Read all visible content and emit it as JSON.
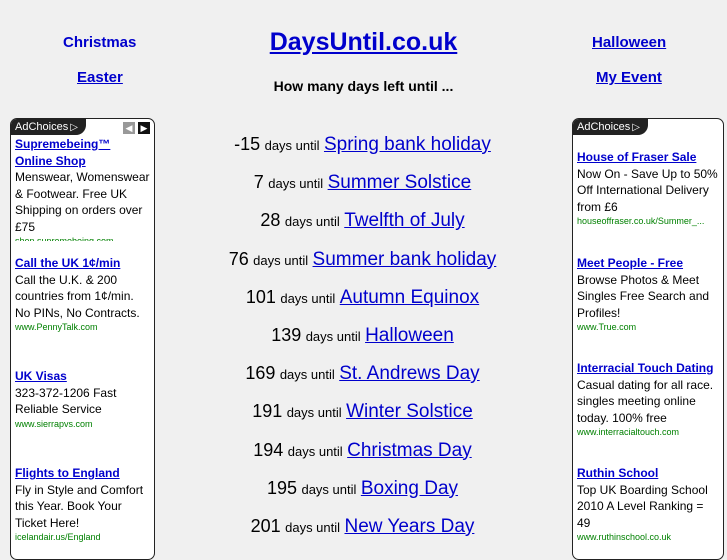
{
  "nav": {
    "christmas": "Christmas",
    "easter": "Easter",
    "halloween": "Halloween",
    "my_event": "My Event"
  },
  "site": {
    "title": "DaysUntil.co.uk",
    "subtitle": "How many days left until ..."
  },
  "ads_left": {
    "adchoices_label": "AdChoices",
    "prev_icon": "chevron-left-icon",
    "next_icon": "chevron-right-icon",
    "items": [
      {
        "title": "Supremebeing™ Online Shop",
        "body": "Menswear, Womenswear & Footwear. Free UK Shipping on orders over £75",
        "url": "shop.supremebeing.com"
      },
      {
        "title": "Call the UK 1¢/min",
        "body": "Call the U.K. & 200 countries from 1¢/min. No PINs, No Contracts.",
        "url": "www.PennyTalk.com"
      },
      {
        "title": "UK Visas",
        "body": "323-372-1206 Fast Reliable Service",
        "url": "www.sierrapvs.com"
      },
      {
        "title": "Flights to England",
        "body": "Fly in Style and Comfort this Year. Book Your Ticket Here!",
        "url": "icelandair.us/England"
      }
    ]
  },
  "ads_right": {
    "adchoices_label": "AdChoices",
    "items": [
      {
        "title": "House of Fraser Sale",
        "body": "Now On - Save Up to 50% Off International Delivery from £6",
        "url": "houseoffraser.co.uk/Summer_..."
      },
      {
        "title": "Meet People - Free",
        "body": "Browse Photos & Meet Singles Free Search and Profiles!",
        "url": "www.True.com"
      },
      {
        "title": "Interracial Touch Dating",
        "body": "Casual dating for all race. singles meeting online today. 100% free",
        "url": "www.interracialtouch.com"
      },
      {
        "title": "Ruthin School",
        "body": "Top UK Boarding School 2010 A Level Ranking = 49",
        "url": "www.ruthinschool.co.uk"
      }
    ]
  },
  "days_until_label": "days until",
  "events": [
    {
      "days": "-15",
      "name": "Spring bank holiday"
    },
    {
      "days": "7",
      "name": "Summer Solstice"
    },
    {
      "days": "28",
      "name": "Twelfth of July"
    },
    {
      "days": "76",
      "name": "Summer bank holiday"
    },
    {
      "days": "101",
      "name": "Autumn Equinox"
    },
    {
      "days": "139",
      "name": "Halloween"
    },
    {
      "days": "169",
      "name": "St. Andrews Day"
    },
    {
      "days": "191",
      "name": "Winter Solstice"
    },
    {
      "days": "194",
      "name": "Christmas Day"
    },
    {
      "days": "195",
      "name": "Boxing Day"
    },
    {
      "days": "201",
      "name": "New Years Day"
    }
  ]
}
